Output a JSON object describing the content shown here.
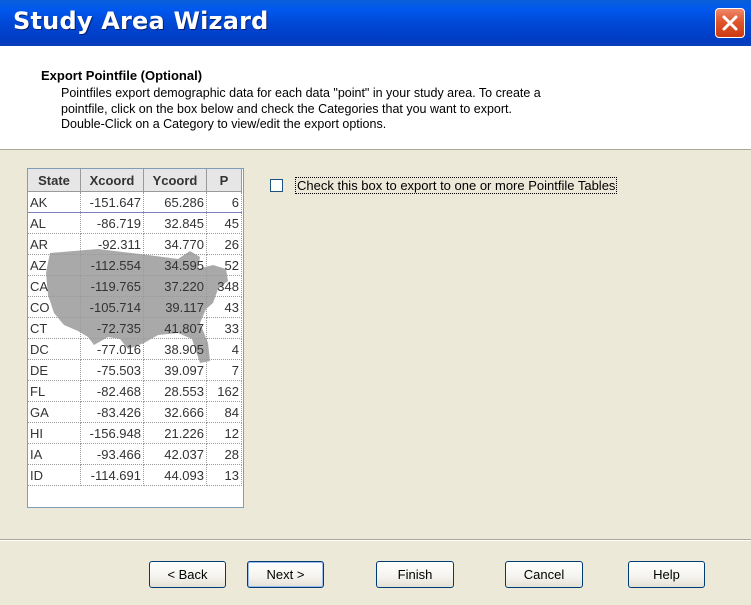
{
  "window": {
    "title": "Study Area Wizard"
  },
  "header": {
    "title": "Export Pointfile (Optional)",
    "lines": [
      "Pointfiles export demographic data for each data \"point\" in your study area.  To create a",
      "pointfile, click on the box below and check the Categories that you want to export.",
      "Double-Click on a Category to view/edit the export options."
    ]
  },
  "table": {
    "columns": [
      "State",
      "Xcoord",
      "Ycoord",
      "P"
    ],
    "rows": [
      [
        "AK",
        "-151.647",
        "65.286",
        "6"
      ],
      [
        "AL",
        "-86.719",
        "32.845",
        "45"
      ],
      [
        "AR",
        "-92.311",
        "34.770",
        "26"
      ],
      [
        "AZ",
        "-112.554",
        "34.595",
        "52"
      ],
      [
        "CA",
        "-119.765",
        "37.220",
        "348"
      ],
      [
        "CO",
        "-105.714",
        "39.117",
        "43"
      ],
      [
        "CT",
        "-72.735",
        "41.807",
        "33"
      ],
      [
        "DC",
        "-77.016",
        "38.905",
        "4"
      ],
      [
        "DE",
        "-75.503",
        "39.097",
        "7"
      ],
      [
        "FL",
        "-82.468",
        "28.553",
        "162"
      ],
      [
        "GA",
        "-83.426",
        "32.666",
        "84"
      ],
      [
        "HI",
        "-156.948",
        "21.226",
        "12"
      ],
      [
        "IA",
        "-93.466",
        "42.037",
        "28"
      ],
      [
        "ID",
        "-114.691",
        "44.093",
        "13"
      ]
    ]
  },
  "export_checkbox": {
    "label": "Check this box to export to one or more Pointfile Tables",
    "checked": false
  },
  "buttons": {
    "back": "< Back",
    "next": "Next >",
    "finish": "Finish",
    "cancel": "Cancel",
    "help": "Help"
  },
  "colors": {
    "titlebar": "#0046d2",
    "dialog_bg": "#ece9d8",
    "close_button": "#e0552c"
  }
}
